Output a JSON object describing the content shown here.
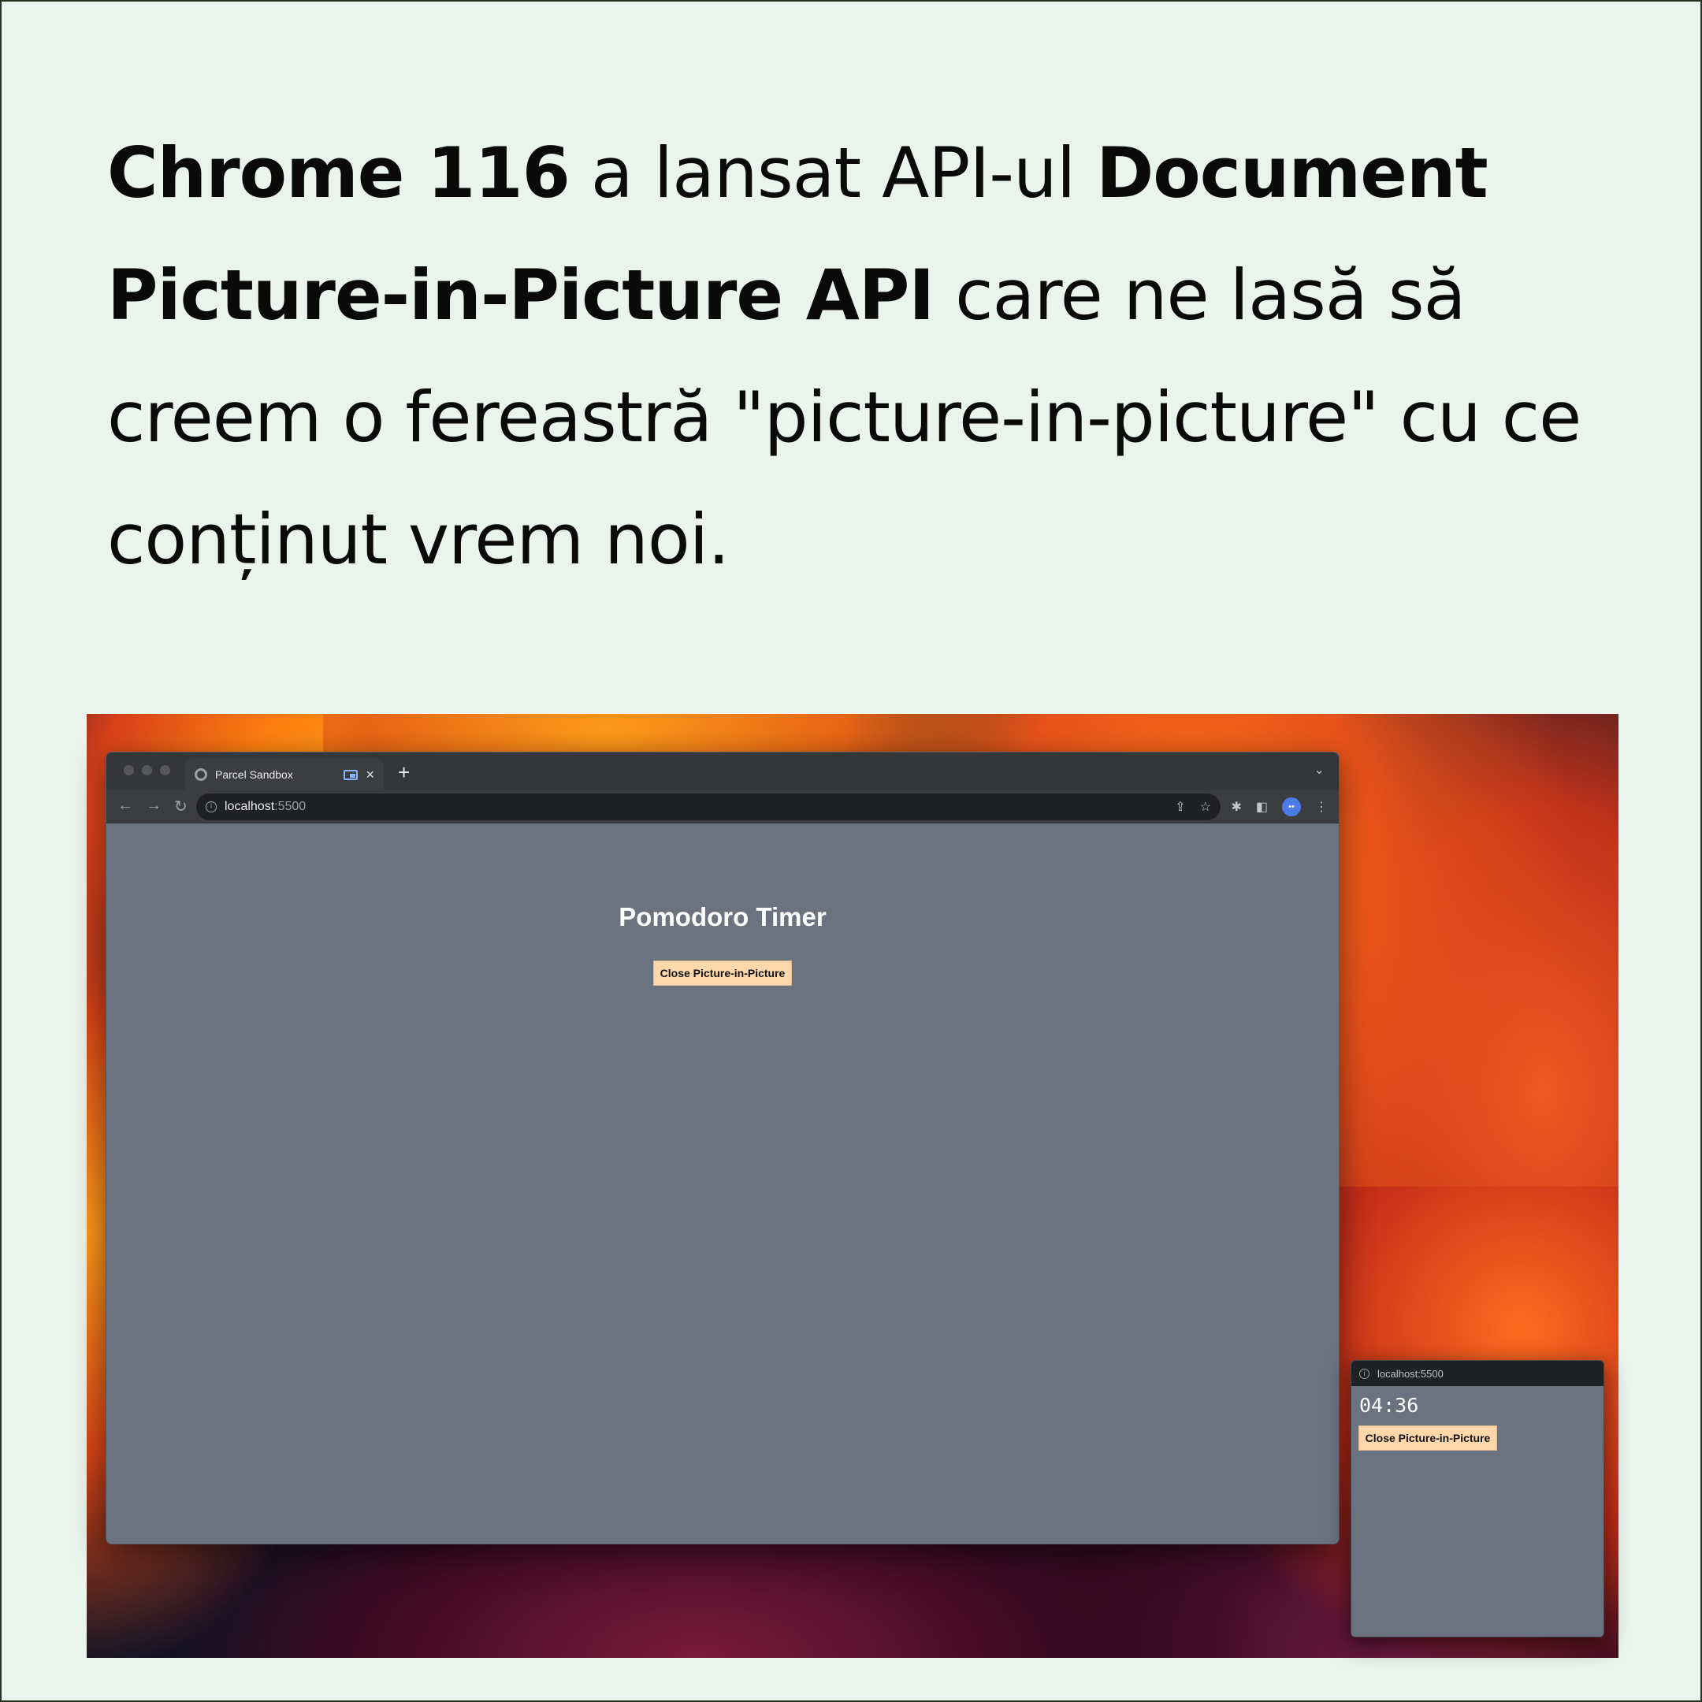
{
  "headline": {
    "bold1": "Chrome 116",
    "text1": " a lansat API-ul ",
    "bold2": "Document Picture-in-Picture API",
    "text2": " care ne lasă să creem o fereastră \"picture-in-picture\" cu ce conținut vrem noi."
  },
  "browser": {
    "tab_title": "Parcel Sandbox",
    "tab_close": "×",
    "new_tab": "+",
    "tab_menu": "⌄",
    "nav_back": "←",
    "nav_forward": "→",
    "nav_reload": "↻",
    "url_host": "localhost",
    "url_port": ":5500",
    "share_icon": "⇪",
    "star_icon": "☆",
    "extensions_icon": "✱",
    "sidepanel_icon": "◧",
    "menu_icon": "⋮",
    "avatar_text": "••"
  },
  "page": {
    "title": "Pomodoro Timer",
    "button_label": "Close Picture-in-Picture"
  },
  "pip": {
    "url": "localhost:5500",
    "time": "04:36",
    "button_label": "Close Picture-in-Picture"
  },
  "colors": {
    "background": "#e9f4ec",
    "page_bg": "#6b7280",
    "button_bg": "#fed7aa"
  }
}
